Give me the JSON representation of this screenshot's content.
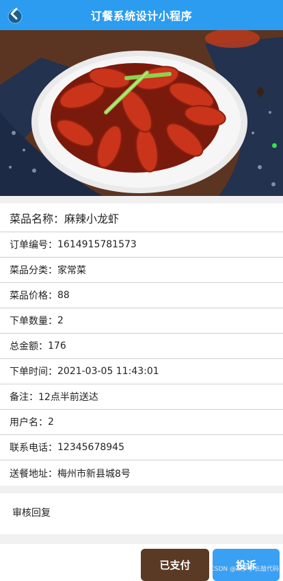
{
  "header": {
    "title": "订餐系统设计小程序",
    "back_icon": "back-arrow-icon"
  },
  "dish": {
    "name_label": "菜品名称：",
    "name_value": "麻辣小龙虾"
  },
  "details": [
    {
      "label": "订单编号：",
      "value": "1614915781573"
    },
    {
      "label": "菜品分类：",
      "value": "家常菜"
    },
    {
      "label": "菜品价格：",
      "value": "88"
    },
    {
      "label": "下单数量：",
      "value": "2"
    },
    {
      "label": "总金额：",
      "value": "176"
    },
    {
      "label": "下单时间：",
      "value": "2021-03-05 11:43:01"
    },
    {
      "label": "备注：",
      "value": "12点半前送达"
    },
    {
      "label": "用户名：",
      "value": "2"
    },
    {
      "label": "联系电话：",
      "value": "12345678945"
    },
    {
      "label": "送餐地址：",
      "value": "梅州市新县城8号"
    }
  ],
  "review": {
    "label": "审核回复"
  },
  "actions": {
    "paid_label": "已支付",
    "complain_label": "投诉"
  },
  "watermark": "CSDN @米罗学长敲代码",
  "colors": {
    "header": "#2c9cf0",
    "paid_button": "#5a3a24",
    "complain_button": "#3aa0f4"
  }
}
